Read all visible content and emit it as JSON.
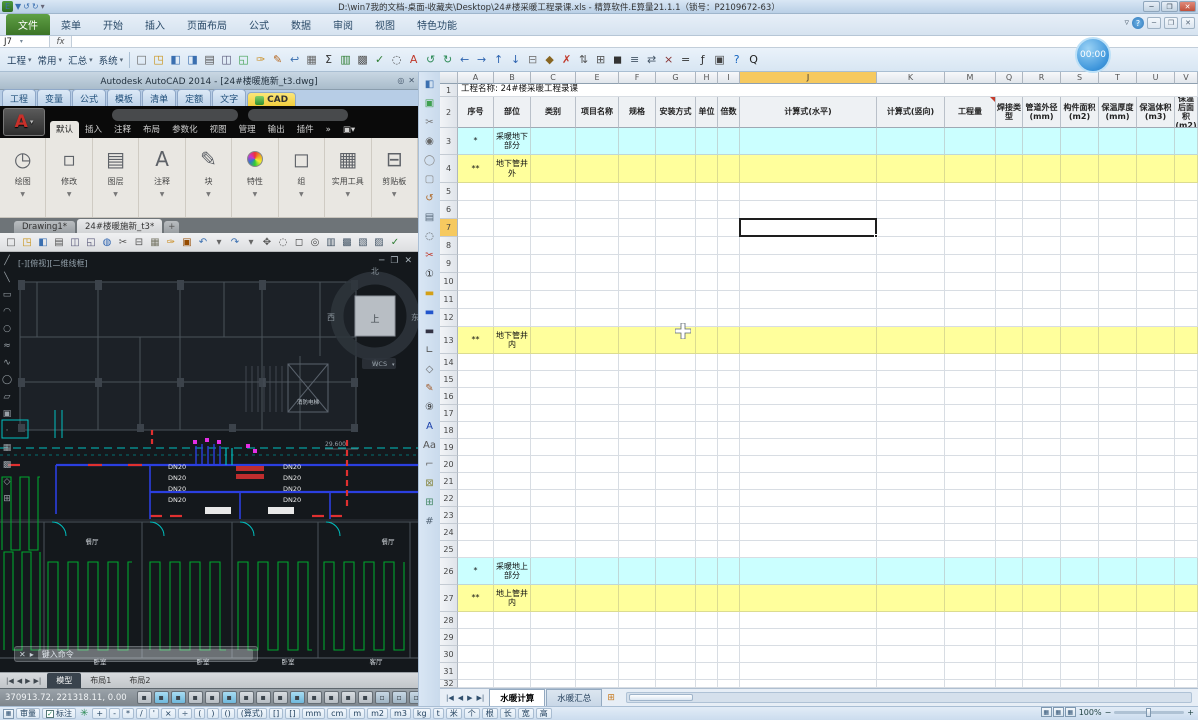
{
  "window": {
    "title": "D:\\win7我的文档-桌面-收藏夹\\Desktop\\24#楼采暖工程录课.xls - 精算软件.E算量21.1.1（锁号：P2109672-63）"
  },
  "quick_access": [
    "app",
    "save",
    "undo",
    "redo",
    "more"
  ],
  "ribbon": {
    "file_tab": "文件",
    "tabs": [
      "菜单",
      "开始",
      "插入",
      "页面布局",
      "公式",
      "数据",
      "审阅",
      "视图",
      "特色功能"
    ],
    "right_controls": [
      "collapse-ribbon",
      "help",
      "minimize",
      "restore",
      "close"
    ]
  },
  "formula_bar": {
    "name_box": "J7",
    "fx": "fx"
  },
  "toolbar": {
    "menus": [
      "工程",
      "常用",
      "汇总",
      "系统"
    ],
    "icons": [
      "new",
      "open",
      "save",
      "save-all",
      "print",
      "print-preview",
      "export",
      "format-brush",
      "edit-pencil",
      "undo",
      "paste-table",
      "autosum",
      "chart",
      "insert-table",
      "check",
      "search",
      "font-color",
      "refresh",
      "repeat",
      "arrow-left",
      "arrow-right",
      "arrow-up",
      "arrow-down",
      "copy",
      "paste-special",
      "delete",
      "sort",
      "borders",
      "fill-color",
      "list",
      "swap",
      "close",
      "equals",
      "calc-key",
      "print-setup",
      "help",
      "qq"
    ]
  },
  "recorder": {
    "time": "00:00"
  },
  "autocad": {
    "titlebar": "Autodesk AutoCAD 2014 - [24#楼暖施新_t3.dwg]",
    "titlebar_controls": [
      "pin",
      "close"
    ],
    "easuan_tabs": [
      "工程",
      "变量",
      "公式",
      "模板",
      "清单",
      "定额",
      "文字",
      "CAD"
    ],
    "easuan_active": "CAD",
    "ribbon_tabs": [
      "默认",
      "插入",
      "注释",
      "布局",
      "参数化",
      "视图",
      "管理",
      "输出",
      "插件"
    ],
    "ribbon_active": "默认",
    "panels": [
      "绘图",
      "修改",
      "图层",
      "注释",
      "块",
      "特性",
      "组",
      "实用工具",
      "剪贴板"
    ],
    "file_tabs": [
      "Drawing1*",
      "24#楼暖施新_t3*"
    ],
    "file_active": "24#楼暖施新_t3*",
    "toolbar_icons": [
      "qnew",
      "open",
      "save",
      "plot",
      "preview",
      "publish",
      "upload",
      "cut",
      "copy",
      "paste",
      "match-props",
      "block-edit",
      "undo",
      "undo-drop",
      "redo",
      "redo-drop",
      "pan",
      "zoom-realtime",
      "zoom-window",
      "zoom-previous",
      "properties",
      "design-center",
      "tool-palettes",
      "sheet-set",
      "markup"
    ],
    "draw_strip_icons": [
      "line",
      "xline",
      "pline",
      "arc",
      "circle",
      "revcloud",
      "spline",
      "ellipse",
      "insert-block",
      "make-block",
      "point",
      "hatch",
      "gradient",
      "region",
      "table"
    ],
    "viewport_label": "[-][俯视][二维线框]",
    "viewport_controls": [
      "minimize",
      "restore",
      "close"
    ],
    "viewcube": {
      "north": "北",
      "south": "南",
      "west": "西",
      "east": "东",
      "top": "上",
      "wcs": "WCS"
    },
    "drawing": {
      "dn20": "DN20",
      "elevation": "29.600",
      "fire_elevator": "消防电梯",
      "rooms": [
        "餐厅",
        "餐厅",
        "卧室",
        "卧室",
        "卧室",
        "客厅"
      ]
    },
    "command_prompt": "键入命令",
    "model_tabs": [
      "模型",
      "布局1",
      "布局2"
    ],
    "model_active": "模型",
    "status": {
      "coords": "370913.72, 221318.11, 0.00",
      "toggles": [
        "infer",
        "snap",
        "grid",
        "ortho",
        "polar",
        "osnap",
        "osnap3d",
        "otrack",
        "ducs",
        "dyn",
        "lwt",
        "transparency",
        "quickprops",
        "cycling"
      ],
      "right_icons": [
        "model-space",
        "quickview-layouts",
        "quickview-drawings",
        "steering-wheel",
        "show-motion",
        "more"
      ]
    }
  },
  "easuan_strip_icons": [
    "save",
    "image-export",
    "screenshot",
    "eye",
    "ellipse",
    "region",
    "undo",
    "doc",
    "search",
    "scissors",
    "num-1",
    "bar-yellow",
    "bar-blue",
    "bar-dark",
    "corner-line",
    "polygon",
    "brush",
    "num-9",
    "text-a",
    "text-aa",
    "dash-rect",
    "box-x",
    "axis-grid",
    "hash-grid"
  ],
  "spreadsheet": {
    "row_header_width": 18,
    "columns": [
      {
        "letter": "A",
        "w": 36
      },
      {
        "letter": "B",
        "w": 37
      },
      {
        "letter": "C",
        "w": 45
      },
      {
        "letter": "E",
        "w": 43
      },
      {
        "letter": "F",
        "w": 37
      },
      {
        "letter": "G",
        "w": 40
      },
      {
        "letter": "H",
        "w": 22
      },
      {
        "letter": "I",
        "w": 22
      },
      {
        "letter": "J",
        "w": 137
      },
      {
        "letter": "K",
        "w": 68
      },
      {
        "letter": "M",
        "w": 51
      },
      {
        "letter": "Q",
        "w": 27
      },
      {
        "letter": "R",
        "w": 38
      },
      {
        "letter": "S",
        "w": 38
      },
      {
        "letter": "T",
        "w": 38
      },
      {
        "letter": "U",
        "w": 38
      },
      {
        "letter": "V",
        "w": 23
      }
    ],
    "title": "工程名称: 24#楼采暖工程录课",
    "headers": [
      "序号",
      "部位",
      "类别",
      "项目名称",
      "规格",
      "安装方式",
      "单位",
      "倍数",
      "计算式(水平)",
      "计算式(竖向)",
      "工程量",
      "焊接类型",
      "管道外径(mm)",
      "构件面积(m2)",
      "保温厚度(mm)",
      "保温体积(m3)",
      "保温后面积(m2)"
    ],
    "comment_marker_col": "M",
    "rows": [
      {
        "n": 1,
        "h": 13,
        "type": "title"
      },
      {
        "n": 2,
        "h": 31,
        "type": "header"
      },
      {
        "n": 3,
        "h": 27,
        "bg": "cyan",
        "a": "*",
        "b": "采暖地下部分"
      },
      {
        "n": 4,
        "h": 28,
        "bg": "yellow",
        "a": "**",
        "b": "地下管井外"
      },
      {
        "n": 5,
        "h": 18
      },
      {
        "n": 6,
        "h": 18
      },
      {
        "n": 7,
        "h": 18
      },
      {
        "n": 8,
        "h": 18
      },
      {
        "n": 9,
        "h": 18
      },
      {
        "n": 10,
        "h": 18
      },
      {
        "n": 11,
        "h": 18
      },
      {
        "n": 12,
        "h": 18
      },
      {
        "n": 13,
        "h": 27,
        "bg": "yellow",
        "a": "**",
        "b": "地下管井内"
      },
      {
        "n": 14,
        "h": 17
      },
      {
        "n": 15,
        "h": 17
      },
      {
        "n": 16,
        "h": 17
      },
      {
        "n": 17,
        "h": 17
      },
      {
        "n": 18,
        "h": 17
      },
      {
        "n": 19,
        "h": 17
      },
      {
        "n": 20,
        "h": 17
      },
      {
        "n": 21,
        "h": 17
      },
      {
        "n": 22,
        "h": 17
      },
      {
        "n": 23,
        "h": 17
      },
      {
        "n": 24,
        "h": 17
      },
      {
        "n": 25,
        "h": 17
      },
      {
        "n": 26,
        "h": 27,
        "bg": "cyan",
        "a": "*",
        "b": "采暖地上部分"
      },
      {
        "n": 27,
        "h": 27,
        "bg": "yellow",
        "a": "**",
        "b": "地上管井内"
      },
      {
        "n": 28,
        "h": 17
      },
      {
        "n": 29,
        "h": 17
      },
      {
        "n": 30,
        "h": 17
      },
      {
        "n": 31,
        "h": 17
      },
      {
        "n": 32,
        "h": 8
      }
    ],
    "selection": {
      "col": "J",
      "row": 7,
      "ref": "J7"
    },
    "colors": {
      "cyan": "#CBFFFF",
      "yellow": "#FFFF9C",
      "selected_header": "#F6C95F"
    }
  },
  "sheet_bar": {
    "nav": [
      "first-sheet",
      "prev-sheet",
      "next-sheet",
      "last-sheet"
    ],
    "tabs": [
      "水暖计算",
      "水暖汇总"
    ],
    "active": "水暖计算",
    "insert": "insert-sheet"
  },
  "bottom_bar": {
    "measure": "审量",
    "annotate": "标注",
    "annotate_checked": true,
    "ops": [
      "+",
      "-",
      "*",
      "/",
      "'",
      "×",
      "÷",
      "(",
      ")",
      "()",
      "(算式)",
      "[]",
      "[]",
      "mm",
      "cm",
      "m",
      "m2",
      "m3",
      "kg",
      "t",
      "米",
      "个",
      "根",
      "长",
      "宽",
      "高"
    ],
    "view_icons": [
      "normal-view",
      "page-layout-view",
      "page-break-view"
    ],
    "zoom_label": "100%"
  }
}
